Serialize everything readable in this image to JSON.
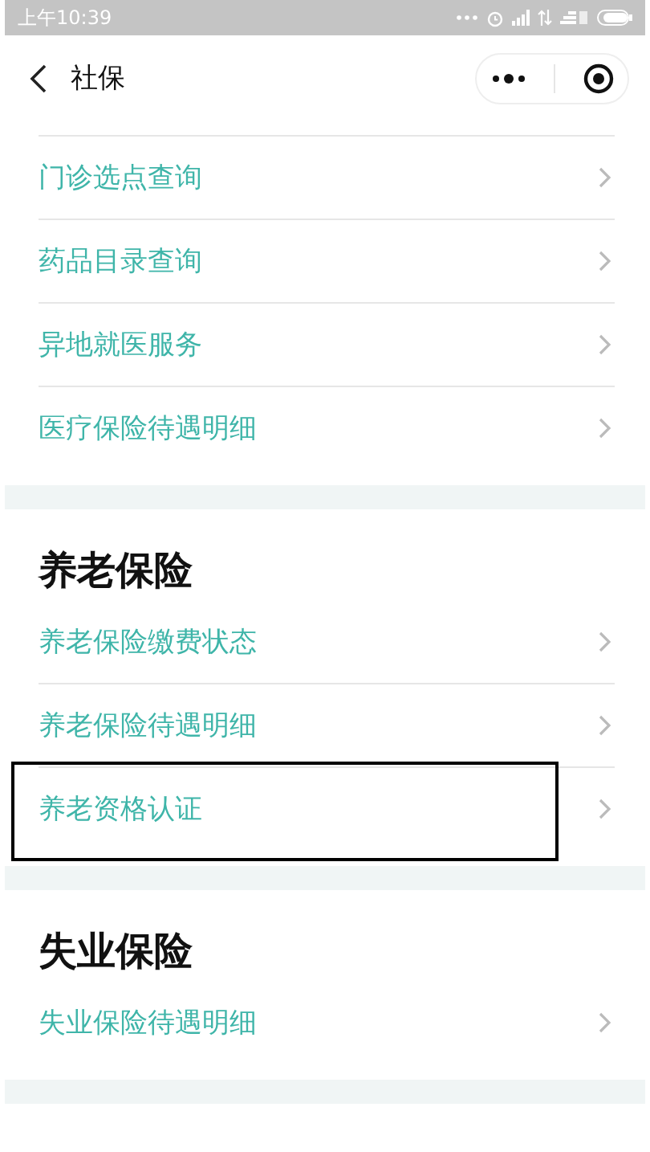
{
  "status_bar": {
    "time": "上午10:39"
  },
  "header": {
    "title": "社保"
  },
  "sections": [
    {
      "items": [
        {
          "label": "门诊选点查询",
          "highlighted": false
        },
        {
          "label": "药品目录查询",
          "highlighted": false
        },
        {
          "label": "异地就医服务",
          "highlighted": false
        },
        {
          "label": "医疗保险待遇明细",
          "highlighted": false
        }
      ]
    },
    {
      "heading": "养老保险",
      "items": [
        {
          "label": "养老保险缴费状态",
          "highlighted": false
        },
        {
          "label": "养老保险待遇明细",
          "highlighted": false
        },
        {
          "label": "养老资格认证",
          "highlighted": true
        }
      ]
    },
    {
      "heading": "失业保险",
      "items": [
        {
          "label": "失业保险待遇明细",
          "highlighted": false
        }
      ]
    }
  ]
}
